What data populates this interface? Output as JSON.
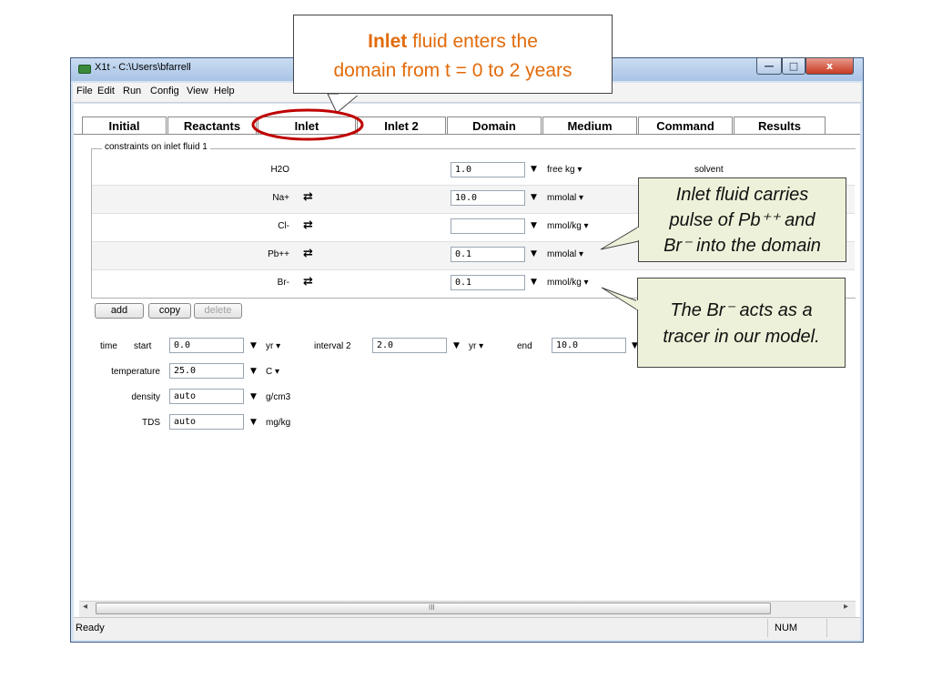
{
  "window": {
    "title": "X1t - C:\\Users\\bfarrell",
    "minimize_glyph": "—",
    "maximize_glyph": "□",
    "close_glyph": "x"
  },
  "menu": [
    "File",
    "Edit",
    "Run",
    "Config",
    "View",
    "Help"
  ],
  "tabs": [
    "Initial",
    "Reactants",
    "Inlet",
    "Inlet 2",
    "Domain",
    "Medium",
    "Command",
    "Results"
  ],
  "selected_tab": "Inlet",
  "constraints": {
    "group_label": "constraints on inlet fluid 1",
    "rows": [
      {
        "species": "H2O",
        "swap": "",
        "value": "1.0",
        "unit": "free kg ▾",
        "note": "solvent"
      },
      {
        "species": "Na+",
        "swap": "⇄",
        "value": "10.0",
        "unit": "mmolal ▾",
        "note": ""
      },
      {
        "species": "Cl-",
        "swap": "⇄",
        "value": "",
        "unit": "mmol/kg ▾",
        "note": ""
      },
      {
        "species": "Pb++",
        "swap": "⇄",
        "value": "0.1",
        "unit": "mmolal ▾",
        "note": ""
      },
      {
        "species": "Br-",
        "swap": "⇄",
        "value": "0.1",
        "unit": "mmol/kg ▾",
        "note": ""
      }
    ],
    "buttons": {
      "add": "add",
      "copy": "copy",
      "delete": "delete"
    }
  },
  "params": {
    "time_label": "time",
    "start_label": "start",
    "start_value": "0.0",
    "start_unit": "yr ▾",
    "interval_label": "interval 2",
    "interval_value": "2.0",
    "interval_unit": "yr ▾",
    "end_label": "end",
    "end_value": "10.0",
    "temperature_label": "temperature",
    "temperature_value": "25.0",
    "temperature_unit": "C ▾",
    "density_label": "density",
    "density_value": "auto",
    "density_unit": "g/cm3",
    "tds_label": "TDS",
    "tds_value": "auto",
    "tds_unit": "mg/kg"
  },
  "dropdown_arrow": "▼",
  "scroll": {
    "left": "◂",
    "right": "▸",
    "grip": "III"
  },
  "status": {
    "text": "Ready",
    "num": "NUM"
  },
  "annotations": {
    "top_bold": "Inlet",
    "top_rest_line1": " fluid enters the",
    "top_line2": "domain from t = 0 to 2 years",
    "carry_line1": "Inlet fluid carries",
    "carry_line2": "pulse of Pb⁺⁺ and",
    "carry_line3": "Br⁻ into the domain",
    "tracer_line1": "The Br⁻ acts as a",
    "tracer_line2": "tracer in our model."
  },
  "colors": {
    "annotation_orange": "#e26b0a",
    "highlight_red": "#c00000",
    "callout_green": "#eef1d9"
  }
}
